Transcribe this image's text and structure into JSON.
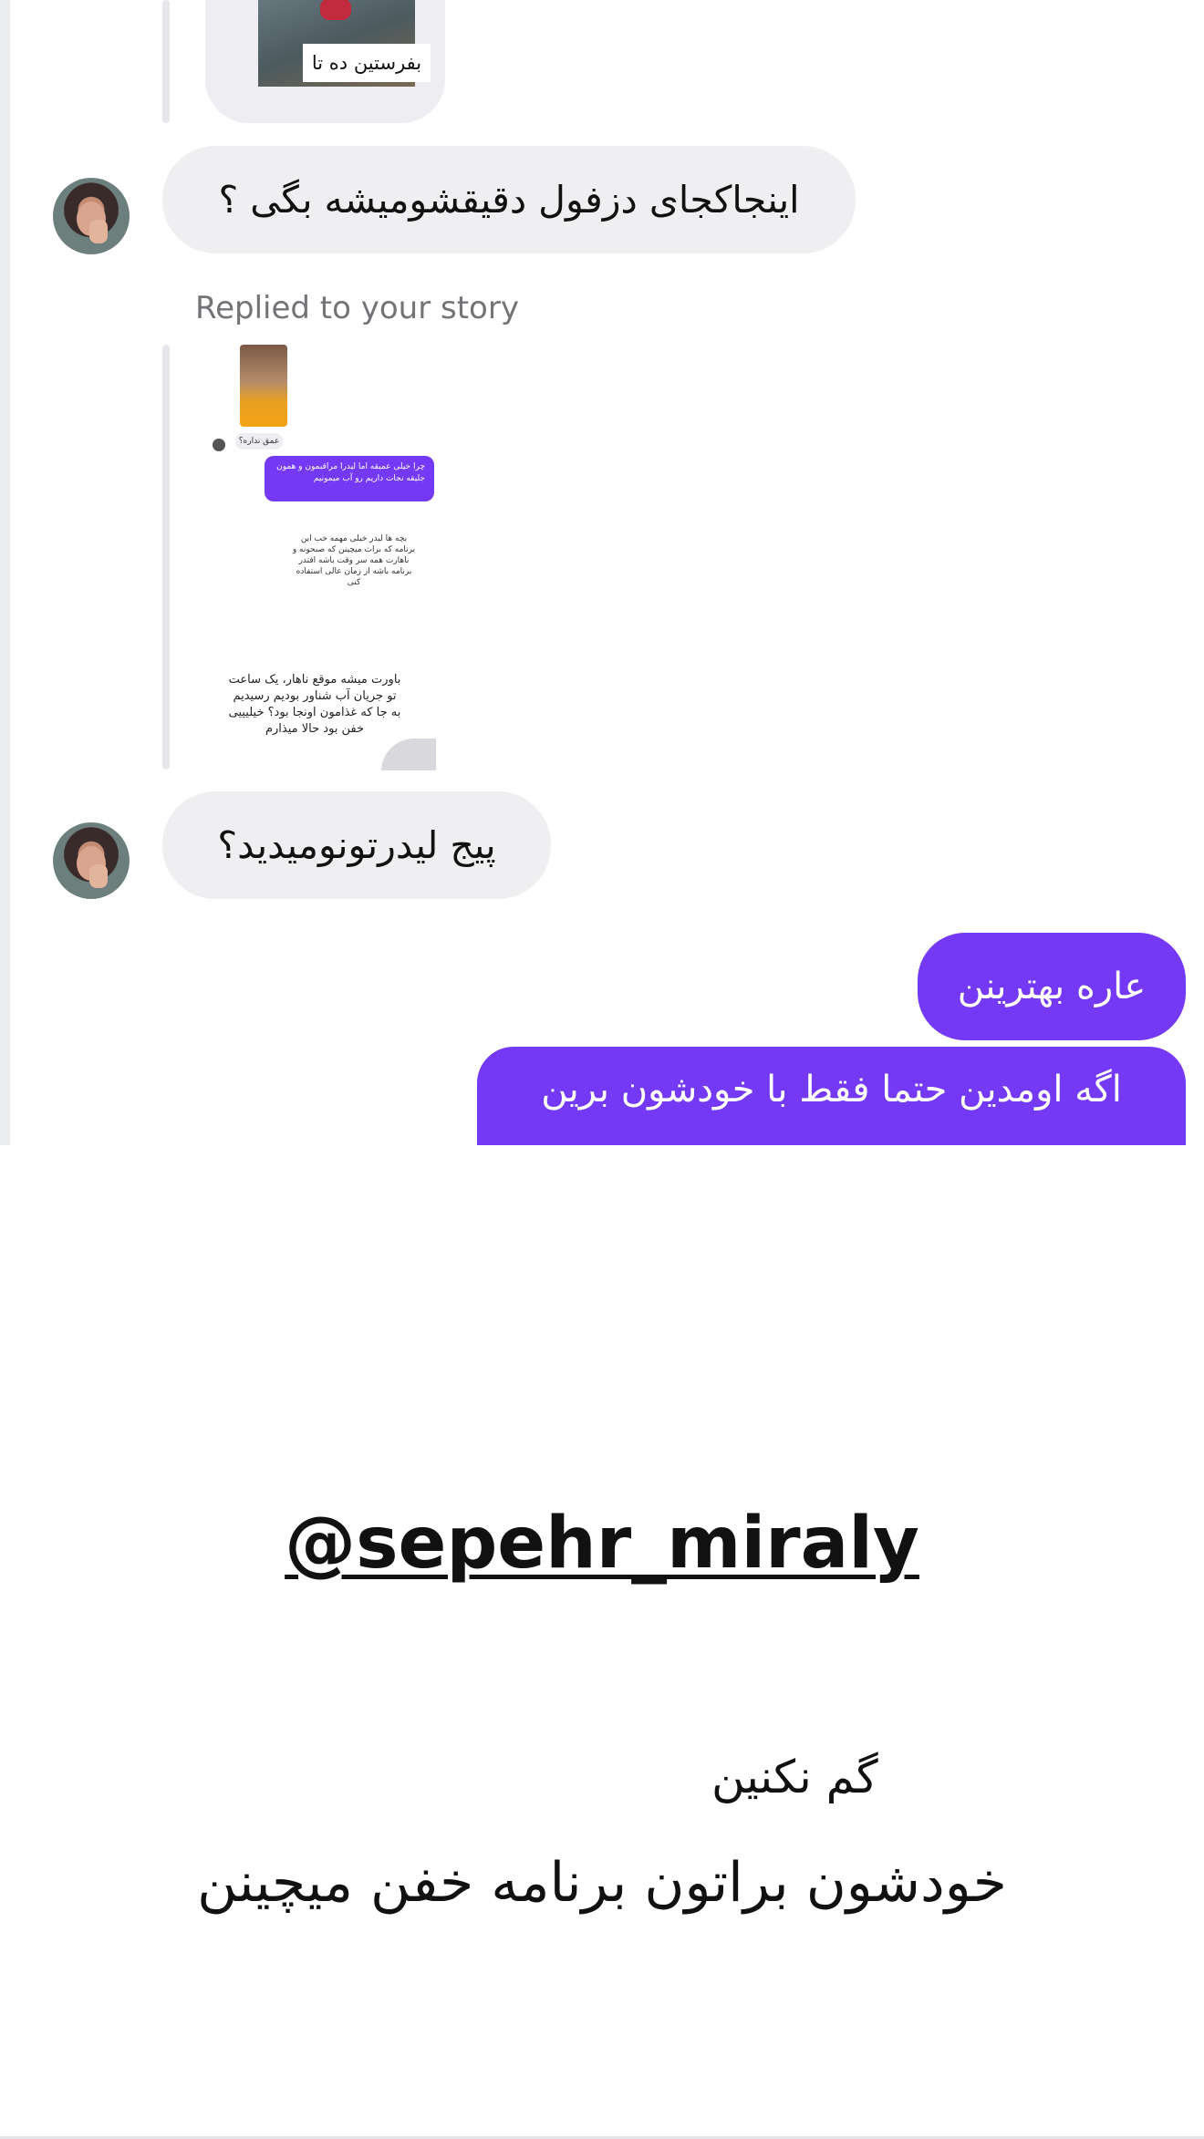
{
  "chat": {
    "previous_media_caption": "بفرستین ده تا",
    "messages": [
      {
        "from": "them",
        "text": "اینجاکجای دزفول دقیقشومیشه بگی ؟"
      },
      {
        "from": "them",
        "text": "پیج لیدرتونومیدید؟"
      },
      {
        "from": "me",
        "text": "عاره بهترینن"
      },
      {
        "from": "me",
        "text": "اگه اومدین حتما فقط با خودشون برین"
      }
    ],
    "story_reply_label": "Replied to your story",
    "story_preview": {
      "incoming_snippet": "عمق نداره؟",
      "outgoing_snippet": "چرا خیلی عمیقه اما لیدرا مراقبمون و همون جلیقه نجات داریم رو آب میمونیم",
      "text_block_1": "بچه ها لیدر خیلی مهمه خب این برنامه که براث میچینن که صبحونه و ناهارت همه سر وقت باشه اقتدر برنامه باشه از زمان عالی استفاده کنی",
      "text_block_2": "باورت میشه موقع ناهار، یک ساعت تو جریان آب شناور بودیم رسیدیم به جا که غذامون اونجا بود؟ خیلیییی خفن بود حالا میذارم"
    }
  },
  "overlay": {
    "handle": "@sepehr_miraly",
    "line1": "گم نکنین",
    "line2": "خودشون براتون برنامه خفن میچینن"
  },
  "colors": {
    "outgoing_bubble": "#7339f5",
    "incoming_bubble": "#efeff2",
    "text": "#111111"
  }
}
